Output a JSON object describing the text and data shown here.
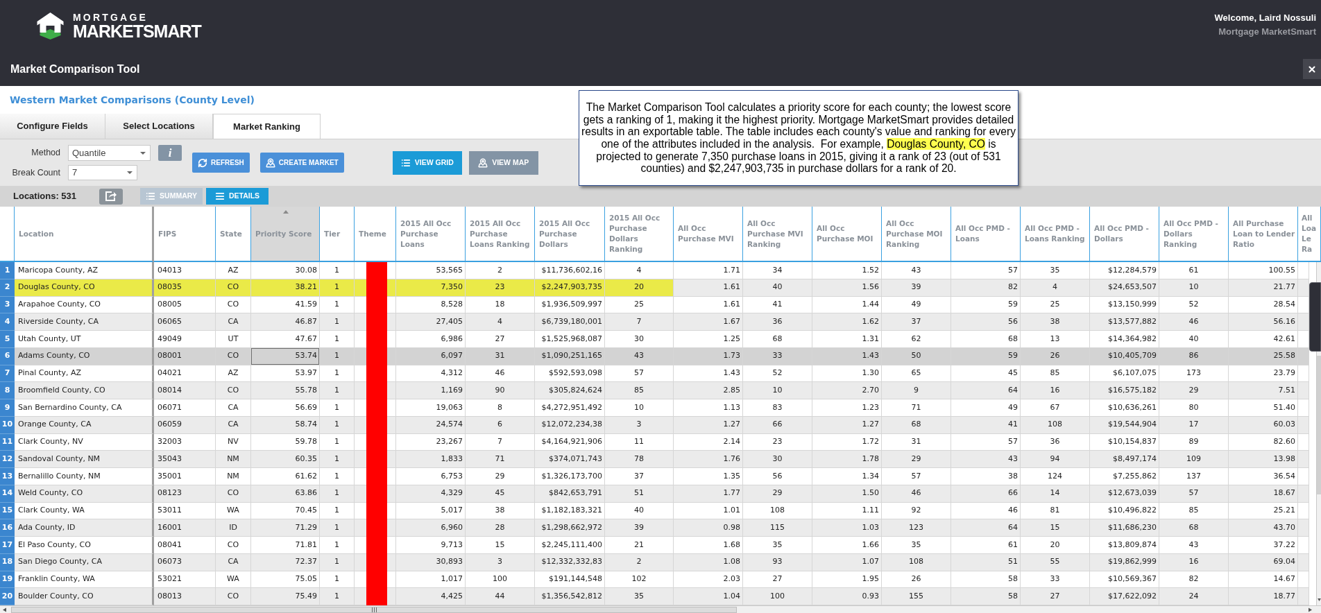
{
  "header": {
    "logo_top": "MORTGAGE",
    "logo_main": "MARKETSMART",
    "welcome": "Welcome, Laird Nossuli",
    "company": "Mortgage MarketSmart"
  },
  "window": {
    "title": "Market Comparison Tool"
  },
  "page_heading": "Western Market Comparisons (County Level)",
  "tabs": [
    {
      "label": "Configure Fields",
      "selected": false
    },
    {
      "label": "Select Locations",
      "selected": false
    },
    {
      "label": "Market Ranking",
      "selected": true
    }
  ],
  "settings": {
    "method_label": "Method",
    "method_value": "Quantile",
    "info_label": "i",
    "break_count_label": "Break Count",
    "break_count_value": "7"
  },
  "actions": [
    {
      "kind": "refresh",
      "label": "REFRESH"
    },
    {
      "kind": "create",
      "label": "CREATE MARKET"
    }
  ],
  "views": [
    {
      "kind": "grid",
      "label": "VIEW GRID",
      "selected": true
    },
    {
      "kind": "map",
      "label": "VIEW MAP",
      "selected": false
    }
  ],
  "status_bar": {
    "locations": "Locations: 531",
    "modes": [
      {
        "kind": "summary",
        "label": "SUMMARY",
        "selected": false
      },
      {
        "kind": "details",
        "label": "DETAILS",
        "selected": true
      }
    ]
  },
  "callout": [
    {
      "text": "The Market Comparison Tool calculates a priority score for each county; the lowest score gets a ranking of 1, making it the highest priority. Mortgage MarketSmart provides detailed results in an exportable table. The table includes each county's value and ranking for every one of the attributes included in the analysis.  For example, ",
      "highlighted": false
    },
    {
      "text": "Douglas County, CO",
      "highlighted": true
    },
    {
      "text": " is projected to generate 7,350 purchase loans in 2015, giving it a rank of 23 (out of 531 counties) and $2,247,903,735 in purchase dollars for a rank of 20.",
      "highlighted": false
    }
  ],
  "table": {
    "columns": [
      {
        "label": "Location",
        "kind": "text",
        "sorted": false,
        "in_highlight": true
      },
      {
        "label": "FIPS",
        "kind": "text",
        "sorted": false,
        "in_highlight": true
      },
      {
        "label": "State",
        "kind": "label",
        "sorted": false,
        "in_highlight": true
      },
      {
        "label": "Priority Score",
        "kind": "number",
        "sorted": true,
        "in_highlight": true
      },
      {
        "label": "Tier",
        "kind": "rank",
        "sorted": false,
        "in_highlight": true
      },
      {
        "label": "Theme",
        "kind": "swatch",
        "sorted": false,
        "in_highlight": true
      },
      {
        "label": "2015 All Occ Purchase Loans",
        "kind": "number",
        "sorted": false,
        "in_highlight": true
      },
      {
        "label": "2015 All Occ Purchase Loans Ranking",
        "kind": "rank",
        "sorted": false,
        "in_highlight": true
      },
      {
        "label": "2015 All Occ Purchase Dollars",
        "kind": "number",
        "sorted": false,
        "in_highlight": true
      },
      {
        "label": "2015 All Occ Purchase Dollars Ranking",
        "kind": "rank",
        "sorted": false,
        "in_highlight": true
      },
      {
        "label": "All Occ Purchase MVI",
        "kind": "number",
        "sorted": false,
        "in_highlight": false
      },
      {
        "label": "All Occ Purchase MVI Ranking",
        "kind": "rank",
        "sorted": false,
        "in_highlight": false
      },
      {
        "label": "All Occ Purchase MOI",
        "kind": "number",
        "sorted": false,
        "in_highlight": false
      },
      {
        "label": "All Occ Purchase MOI Ranking",
        "kind": "rank",
        "sorted": false,
        "in_highlight": false
      },
      {
        "label": "All Occ PMD - Loans",
        "kind": "number",
        "sorted": false,
        "in_highlight": false
      },
      {
        "label": "All Occ PMD - Loans Ranking",
        "kind": "rank",
        "sorted": false,
        "in_highlight": false
      },
      {
        "label": "All Occ PMD - Dollars",
        "kind": "number",
        "sorted": false,
        "in_highlight": false
      },
      {
        "label": "All Occ PMD - Dollars Ranking",
        "kind": "rank",
        "sorted": false,
        "in_highlight": false
      },
      {
        "label": "All Purchase Loan to Lender Ratio",
        "kind": "number",
        "sorted": false,
        "in_highlight": false
      },
      {
        "label": "All Loa Le Ra",
        "kind": "rank",
        "sorted": false,
        "in_highlight": false
      }
    ],
    "rows": [
      {
        "number": "1",
        "cells": [
          "Maricopa County, AZ",
          "04013",
          "AZ",
          "30.08",
          "1",
          "",
          "53,565",
          "2",
          "$11,736,602,16",
          "4",
          "1.71",
          "34",
          "1.52",
          "43",
          "57",
          "35",
          "$12,284,579",
          "61",
          "100.55"
        ],
        "color": "#ff0000",
        "selected": false,
        "highlighted": false
      },
      {
        "number": "2",
        "cells": [
          "Douglas County, CO",
          "08035",
          "CO",
          "38.21",
          "1",
          "",
          "7,350",
          "23",
          "$2,247,903,735",
          "20",
          "1.61",
          "40",
          "1.56",
          "39",
          "82",
          "4",
          "$24,653,507",
          "10",
          "21.77"
        ],
        "color": "#ff0000",
        "selected": false,
        "highlighted": true
      },
      {
        "number": "3",
        "cells": [
          "Arapahoe County, CO",
          "08005",
          "CO",
          "41.59",
          "1",
          "",
          "8,528",
          "18",
          "$1,936,509,997",
          "25",
          "1.61",
          "41",
          "1.44",
          "49",
          "59",
          "25",
          "$13,150,999",
          "52",
          "28.54"
        ],
        "color": "#ff0000",
        "selected": false,
        "highlighted": false
      },
      {
        "number": "4",
        "cells": [
          "Riverside County, CA",
          "06065",
          "CA",
          "46.87",
          "1",
          "",
          "27,405",
          "4",
          "$6,739,180,001",
          "7",
          "1.67",
          "36",
          "1.62",
          "37",
          "56",
          "38",
          "$13,577,882",
          "46",
          "56.16"
        ],
        "color": "#ff0000",
        "selected": false,
        "highlighted": false
      },
      {
        "number": "5",
        "cells": [
          "Utah County, UT",
          "49049",
          "UT",
          "47.67",
          "1",
          "",
          "6,986",
          "27",
          "$1,525,968,087",
          "30",
          "1.25",
          "68",
          "1.31",
          "62",
          "68",
          "13",
          "$14,364,982",
          "40",
          "42.61"
        ],
        "color": "#ff0000",
        "selected": false,
        "highlighted": false
      },
      {
        "number": "6",
        "cells": [
          "Adams County, CO",
          "08001",
          "CO",
          "53.74",
          "1",
          "",
          "6,097",
          "31",
          "$1,090,251,165",
          "43",
          "1.73",
          "33",
          "1.43",
          "50",
          "59",
          "26",
          "$10,405,709",
          "86",
          "25.58"
        ],
        "color": "#ff0000",
        "selected": true,
        "highlighted": false
      },
      {
        "number": "7",
        "cells": [
          "Pinal County, AZ",
          "04021",
          "AZ",
          "53.97",
          "1",
          "",
          "4,312",
          "46",
          "$592,593,098",
          "57",
          "1.43",
          "52",
          "1.30",
          "65",
          "45",
          "85",
          "$6,107,075",
          "173",
          "23.79"
        ],
        "color": "#ff0000",
        "selected": false,
        "highlighted": false
      },
      {
        "number": "8",
        "cells": [
          "Broomfield County, CO",
          "08014",
          "CO",
          "55.78",
          "1",
          "",
          "1,169",
          "90",
          "$305,824,624",
          "85",
          "2.85",
          "10",
          "2.70",
          "9",
          "64",
          "16",
          "$16,575,182",
          "29",
          "7.51"
        ],
        "color": "#ff0000",
        "selected": false,
        "highlighted": false
      },
      {
        "number": "9",
        "cells": [
          "San Bernardino County, CA",
          "06071",
          "CA",
          "56.69",
          "1",
          "",
          "19,063",
          "8",
          "$4,272,951,492",
          "10",
          "1.13",
          "83",
          "1.23",
          "71",
          "49",
          "67",
          "$10,636,261",
          "80",
          "51.40"
        ],
        "color": "#ff0000",
        "selected": false,
        "highlighted": false
      },
      {
        "number": "10",
        "cells": [
          "Orange County, CA",
          "06059",
          "CA",
          "58.74",
          "1",
          "",
          "24,574",
          "6",
          "$12,072,234,38",
          "3",
          "1.27",
          "66",
          "1.27",
          "68",
          "41",
          "108",
          "$19,544,904",
          "17",
          "60.03"
        ],
        "color": "#ff0000",
        "selected": false,
        "highlighted": false
      },
      {
        "number": "11",
        "cells": [
          "Clark County, NV",
          "32003",
          "NV",
          "59.78",
          "1",
          "",
          "23,267",
          "7",
          "$4,164,921,906",
          "11",
          "2.14",
          "23",
          "1.72",
          "31",
          "57",
          "36",
          "$10,154,837",
          "89",
          "82.60"
        ],
        "color": "#ff0000",
        "selected": false,
        "highlighted": false
      },
      {
        "number": "12",
        "cells": [
          "Sandoval County, NM",
          "35043",
          "NM",
          "60.35",
          "1",
          "",
          "1,833",
          "71",
          "$374,071,743",
          "78",
          "1.76",
          "30",
          "1.78",
          "29",
          "43",
          "94",
          "$8,497,174",
          "109",
          "13.98"
        ],
        "color": "#ff0000",
        "selected": false,
        "highlighted": false
      },
      {
        "number": "13",
        "cells": [
          "Bernalillo County, NM",
          "35001",
          "NM",
          "61.62",
          "1",
          "",
          "6,753",
          "29",
          "$1,326,173,700",
          "37",
          "1.35",
          "56",
          "1.34",
          "57",
          "38",
          "124",
          "$7,255,862",
          "137",
          "36.54"
        ],
        "color": "#ff0000",
        "selected": false,
        "highlighted": false
      },
      {
        "number": "14",
        "cells": [
          "Weld County, CO",
          "08123",
          "CO",
          "63.86",
          "1",
          "",
          "4,329",
          "45",
          "$842,653,791",
          "51",
          "1.77",
          "29",
          "1.50",
          "46",
          "66",
          "14",
          "$12,673,039",
          "57",
          "18.67"
        ],
        "color": "#ff0000",
        "selected": false,
        "highlighted": false
      },
      {
        "number": "15",
        "cells": [
          "Clark County, WA",
          "53011",
          "WA",
          "70.45",
          "1",
          "",
          "5,017",
          "38",
          "$1,182,183,321",
          "40",
          "1.01",
          "108",
          "1.11",
          "92",
          "46",
          "81",
          "$10,496,822",
          "85",
          "25.21"
        ],
        "color": "#ff0000",
        "selected": false,
        "highlighted": false
      },
      {
        "number": "16",
        "cells": [
          "Ada County, ID",
          "16001",
          "ID",
          "71.29",
          "1",
          "",
          "6,960",
          "28",
          "$1,298,662,972",
          "39",
          "0.98",
          "115",
          "1.03",
          "123",
          "64",
          "15",
          "$11,686,230",
          "68",
          "43.70"
        ],
        "color": "#ff0000",
        "selected": false,
        "highlighted": false
      },
      {
        "number": "17",
        "cells": [
          "El Paso County, CO",
          "08041",
          "CO",
          "71.81",
          "1",
          "",
          "9,713",
          "15",
          "$2,245,111,400",
          "21",
          "1.68",
          "35",
          "1.66",
          "35",
          "61",
          "20",
          "$13,809,874",
          "43",
          "37.22"
        ],
        "color": "#ff0000",
        "selected": false,
        "highlighted": false
      },
      {
        "number": "18",
        "cells": [
          "San Diego County, CA",
          "06073",
          "CA",
          "72.37",
          "1",
          "",
          "30,893",
          "3",
          "$12,332,332,83",
          "2",
          "1.08",
          "93",
          "1.07",
          "108",
          "51",
          "55",
          "$19,862,999",
          "16",
          "69.04"
        ],
        "color": "#ff0000",
        "selected": false,
        "highlighted": false
      },
      {
        "number": "19",
        "cells": [
          "Franklin County, WA",
          "53021",
          "WA",
          "75.05",
          "1",
          "",
          "1,017",
          "100",
          "$191,144,548",
          "102",
          "2.03",
          "27",
          "1.95",
          "26",
          "58",
          "33",
          "$10,569,367",
          "82",
          "14.67"
        ],
        "color": "#ff0000",
        "selected": false,
        "highlighted": false
      },
      {
        "number": "20",
        "cells": [
          "Boulder County, CO",
          "08013",
          "CO",
          "75.49",
          "1",
          "",
          "4,425",
          "44",
          "$1,356,542,812",
          "35",
          "1.04",
          "100",
          "0.93",
          "155",
          "58",
          "27",
          "$17,622,092",
          "24",
          "18.77"
        ],
        "color": "#ff0000",
        "selected": false,
        "highlighted": false
      }
    ]
  }
}
